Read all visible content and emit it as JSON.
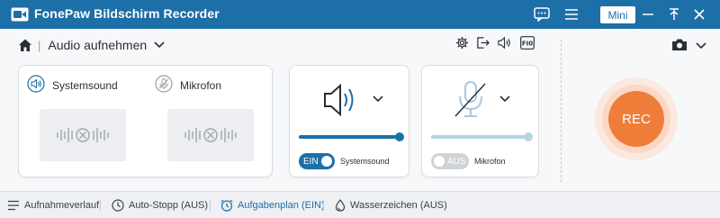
{
  "app": {
    "title": "FonePaw Bildschirm Recorder",
    "mini_label": "Mini"
  },
  "mode": {
    "label": "Audio aufnehmen"
  },
  "sources": {
    "system": {
      "label": "Systemsound"
    },
    "mic": {
      "label": "Mikrofon"
    }
  },
  "system_control": {
    "volume_fraction": 1.0,
    "toggle_label": "EIN",
    "toggle_on": true,
    "caption": "Systemsound"
  },
  "mic_control": {
    "volume_fraction": 1.0,
    "toggle_label": "AUS",
    "toggle_on": false,
    "caption": "Mikrofon"
  },
  "record": {
    "label": "REC"
  },
  "bottom": {
    "history": "Aufnahmeverlauf",
    "autostop": "Auto-Stopp (AUS)",
    "schedule": "Aufgabenplan (EIN)",
    "watermark": "Wasserzeichen (AUS)"
  },
  "colors": {
    "accent": "#1d6fa7",
    "record": "#ef7d3a",
    "mic_disabled": "#a9c8dc"
  }
}
